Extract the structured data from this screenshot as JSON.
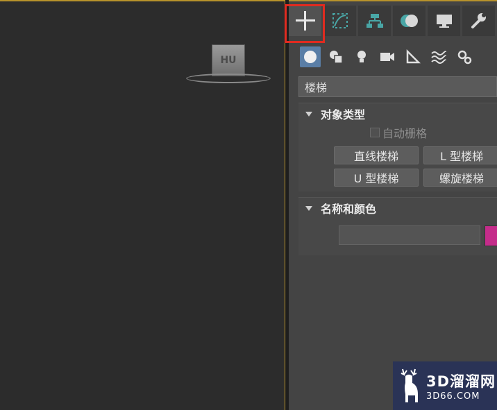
{
  "viewport": {
    "viewcube_label": "HU"
  },
  "command_panel": {
    "tabs": [
      {
        "name": "create",
        "icon": "plus-icon",
        "active": true
      },
      {
        "name": "modify",
        "icon": "modify-curve-icon",
        "active": false
      },
      {
        "name": "hierarchy",
        "icon": "hierarchy-icon",
        "active": false
      },
      {
        "name": "motion",
        "icon": "motion-icon",
        "active": false
      },
      {
        "name": "display",
        "icon": "monitor-icon",
        "active": false
      },
      {
        "name": "utilities",
        "icon": "wrench-icon",
        "active": false
      }
    ],
    "subcategories": [
      {
        "name": "geometry",
        "icon": "sphere-icon",
        "active": true
      },
      {
        "name": "shapes",
        "icon": "shapes-icon"
      },
      {
        "name": "lights",
        "icon": "light-bulb-icon"
      },
      {
        "name": "cameras",
        "icon": "camera-icon"
      },
      {
        "name": "helpers",
        "icon": "set-square-icon"
      },
      {
        "name": "space-warps",
        "icon": "waves-icon"
      },
      {
        "name": "systems",
        "icon": "gears-icon"
      }
    ],
    "type_dropdown_value": "楼梯",
    "object_type": {
      "title": "对象类型",
      "autogrid_label": "自动栅格",
      "buttons": [
        "直线楼梯",
        "L 型楼梯",
        "U 型楼梯",
        "螺旋楼梯"
      ]
    },
    "name_and_color": {
      "title": "名称和颜色",
      "name_value": "",
      "color": "#c42c8a"
    }
  },
  "watermark": {
    "title": "3D溜溜网",
    "domain": "3D66.COM"
  },
  "colors": {
    "highlight": "#e02b20",
    "accent_active": "#5a7ea6",
    "viewport_border": "#b8932b"
  }
}
